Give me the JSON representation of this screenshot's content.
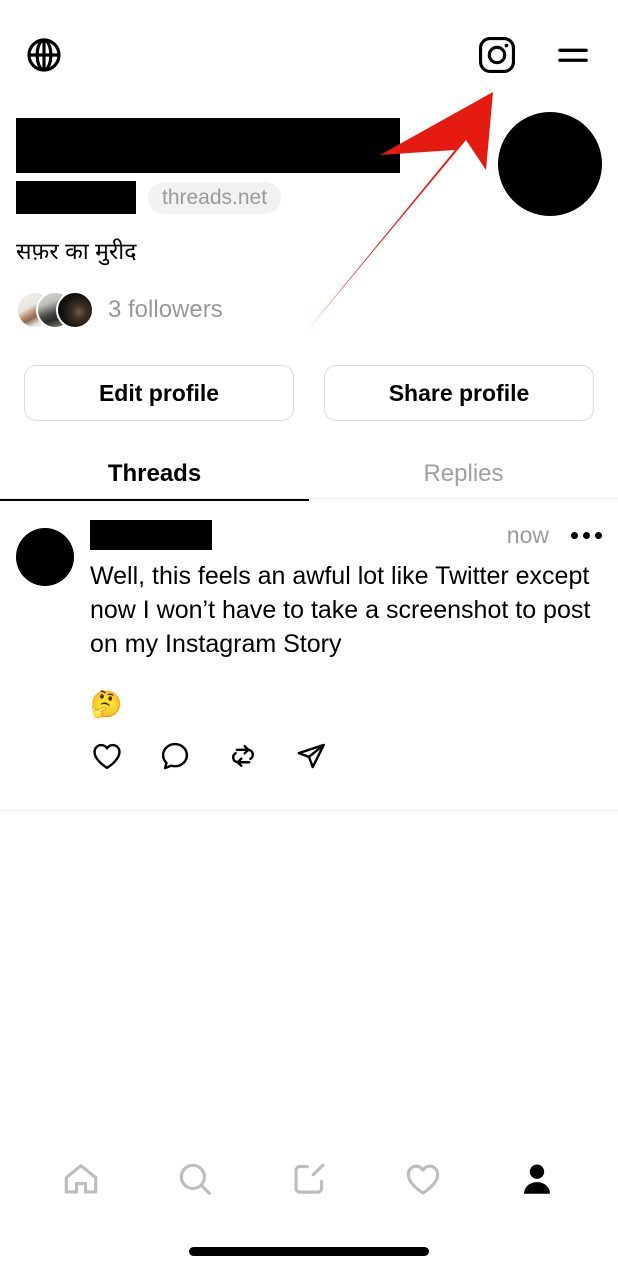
{
  "app": {
    "name": "Threads",
    "screen": "profile"
  },
  "topbar": {
    "globe_icon": "globe-icon",
    "instagram_icon": "instagram-icon",
    "menu_icon": "hamburger-menu-icon"
  },
  "profile": {
    "display_name": "",
    "display_name_redacted": true,
    "username": "",
    "username_redacted": true,
    "domain_badge": "threads.net",
    "bio": "सफ़र का मुरीद",
    "followers_text": "3 followers",
    "followers_count": 3,
    "avatar": "profile-avatar",
    "facepile_count": 3
  },
  "buttons": {
    "edit_profile": "Edit profile",
    "share_profile": "Share profile"
  },
  "tabs": [
    {
      "label": "Threads",
      "active": true
    },
    {
      "label": "Replies",
      "active": false
    }
  ],
  "post": {
    "author_name": "",
    "author_name_redacted": true,
    "timestamp": "now",
    "text": "Well, this feels an awful lot like Twitter except now I won’t have to take a screenshot to post on my Instagram Story",
    "emoji": "🤔",
    "more_options": "•••",
    "actions": [
      {
        "name": "like",
        "icon": "heart-icon"
      },
      {
        "name": "reply",
        "icon": "comment-icon"
      },
      {
        "name": "repost",
        "icon": "repost-icon"
      },
      {
        "name": "share",
        "icon": "share-icon"
      }
    ]
  },
  "bottom_nav": [
    {
      "name": "home",
      "icon": "home-icon",
      "active": false
    },
    {
      "name": "search",
      "icon": "search-icon",
      "active": false
    },
    {
      "name": "compose",
      "icon": "compose-icon",
      "active": false
    },
    {
      "name": "activity",
      "icon": "heart-icon",
      "active": false
    },
    {
      "name": "profile",
      "icon": "person-icon",
      "active": true
    }
  ],
  "annotation": {
    "type": "arrow",
    "color": "#E51B12",
    "points_to": "instagram-icon",
    "description": "Red arrow pointing up-right at the Instagram icon in the top bar"
  },
  "colors": {
    "background": "#ffffff",
    "text_primary": "#000000",
    "text_muted": "#9a9a9a",
    "badge_bg": "#f2f2f2",
    "border": "#dcdcdc",
    "divider": "#efefef",
    "annotation_red": "#E51B12",
    "nav_inactive": "#bdbdbd"
  }
}
